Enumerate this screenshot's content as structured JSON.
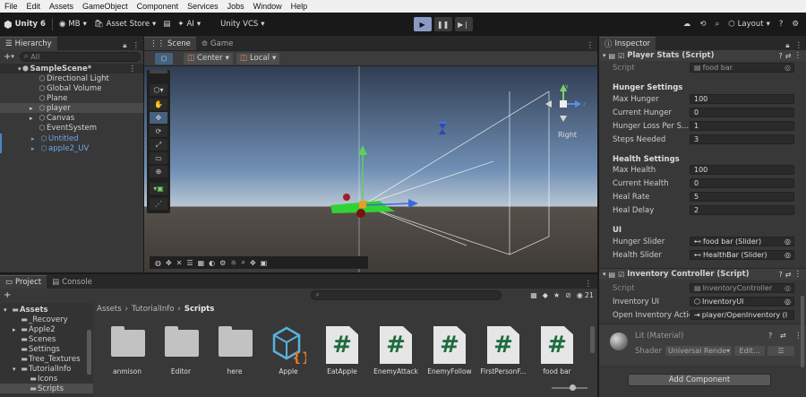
{
  "menubar": {
    "items": [
      "File",
      "Edit",
      "Assets",
      "GameObject",
      "Component",
      "Services",
      "Jobs",
      "Window",
      "Help"
    ]
  },
  "toolbar": {
    "app_title": "Unity 6",
    "account": "MB",
    "asset_store": "Asset Store",
    "ai": "AI",
    "vcs": "Unity VCS",
    "layout": "Layout"
  },
  "hierarchy": {
    "tab": "Hierarchy",
    "search_placeholder": "All",
    "scene_name": "SampleScene*",
    "items": [
      "Directional Light",
      "Global Volume",
      "Plane",
      "player",
      "Canvas",
      "EventSystem",
      "Untitled",
      "apple2_UV"
    ]
  },
  "scene": {
    "tab_scene": "Scene",
    "tab_game": "Game",
    "pivot": "Center",
    "space": "Local",
    "gizmo_label": "Right"
  },
  "project": {
    "tab_project": "Project",
    "tab_console": "Console",
    "count": "21",
    "breadcrumb": [
      "Assets",
      "TutorialInfo",
      "Scripts"
    ],
    "tree": [
      "Assets",
      "_Recovery",
      "Apple2",
      "Scenes",
      "Settings",
      "Tree_Textures",
      "TutorialInfo",
      "Icons",
      "Scripts"
    ],
    "assets": [
      {
        "name": "anmison",
        "kind": "folder"
      },
      {
        "name": "Editor",
        "kind": "folder"
      },
      {
        "name": "here",
        "kind": "folder"
      },
      {
        "name": "Apple",
        "kind": "prefab"
      },
      {
        "name": "EatApple",
        "kind": "script"
      },
      {
        "name": "EnemyAttack",
        "kind": "script"
      },
      {
        "name": "EnemyFollow",
        "kind": "script"
      },
      {
        "name": "FirstPersonF...",
        "kind": "script"
      },
      {
        "name": "food bar",
        "kind": "script"
      }
    ]
  },
  "inspector": {
    "tab": "Inspector",
    "player_stats": {
      "title": "Player Stats (Script)",
      "script_label": "Script",
      "script_value": "food bar",
      "hunger_header": "Hunger Settings",
      "hunger_fields": [
        {
          "label": "Max Hunger",
          "value": "100"
        },
        {
          "label": "Current Hunger",
          "value": "0"
        },
        {
          "label": "Hunger Loss Per S...",
          "value": "1"
        },
        {
          "label": "Steps Needed",
          "value": "3"
        }
      ],
      "health_header": "Health Settings",
      "health_fields": [
        {
          "label": "Max Health",
          "value": "100"
        },
        {
          "label": "Current Health",
          "value": "0"
        },
        {
          "label": "Heal Rate",
          "value": "5"
        },
        {
          "label": "Heal Delay",
          "value": "2"
        }
      ],
      "ui_header": "UI",
      "ui_fields": [
        {
          "label": "Hunger Slider",
          "value": "food bar (Slider)"
        },
        {
          "label": "Health Slider",
          "value": "HealthBar (Slider)"
        }
      ]
    },
    "inventory": {
      "title": "Inventory Controller (Script)",
      "script_label": "Script",
      "script_value": "InventoryController",
      "inv_label": "Inventory UI",
      "inv_value": "InventoryUI",
      "open_label": "Open Inventory Action",
      "open_value": "player/OpenInventory (I"
    },
    "material": {
      "name": "Lit (Material)",
      "shader_label": "Shader",
      "shader_value": "Universal Rende",
      "edit": "Edit...",
      "extra": "☰"
    },
    "add_component": "Add Component"
  }
}
